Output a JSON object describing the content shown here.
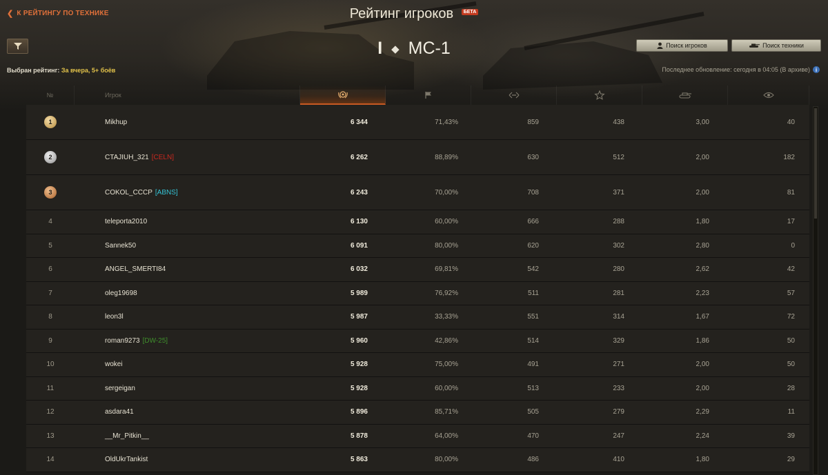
{
  "nav": {
    "back_label": "К РЕЙТИНГУ ПО ТЕХНИКЕ"
  },
  "header": {
    "title": "Рейтинг игроков",
    "beta_badge": "БЕТА",
    "tank_tier": "I",
    "tank_name": "МС-1"
  },
  "toolbar": {
    "player_search_label": "Поиск игроков",
    "tank_search_label": "Поиск техники"
  },
  "selected_rating": {
    "label": "Выбран рейтинг:",
    "value": "За вчера, 5+ боёв"
  },
  "last_update": "Последнее обновление: сегодня в 04:05 (В архиве)",
  "table": {
    "headers": {
      "rank": "№",
      "player": "Игрок",
      "score_icon": "laurel-icon",
      "wins_icon": "flag-icon",
      "damage_icon": "damage-icon",
      "exp_icon": "star-icon",
      "frags_icon": "tank-icon",
      "spotted_icon": "eye-icon"
    },
    "active_column": "score",
    "rows": [
      {
        "rank": "1",
        "player": "Mikhup",
        "clan": "",
        "clan_color": "",
        "score": "6 344",
        "wins": "71,43%",
        "damage": "859",
        "exp": "438",
        "frags": "3,00",
        "spotted": "40"
      },
      {
        "rank": "2",
        "player": "CTAJIUH_321",
        "clan": "[CELN]",
        "clan_color": "#c9281f",
        "score": "6 262",
        "wins": "88,89%",
        "damage": "630",
        "exp": "512",
        "frags": "2,00",
        "spotted": "182"
      },
      {
        "rank": "3",
        "player": "COKOL_CCCP",
        "clan": "[ABNS]",
        "clan_color": "#35c4d6",
        "score": "6 243",
        "wins": "70,00%",
        "damage": "708",
        "exp": "371",
        "frags": "2,00",
        "spotted": "81"
      },
      {
        "rank": "4",
        "player": "teleporta2010",
        "clan": "",
        "clan_color": "",
        "score": "6 130",
        "wins": "60,00%",
        "damage": "666",
        "exp": "288",
        "frags": "1,80",
        "spotted": "17"
      },
      {
        "rank": "5",
        "player": "Sannek50",
        "clan": "",
        "clan_color": "",
        "score": "6 091",
        "wins": "80,00%",
        "damage": "620",
        "exp": "302",
        "frags": "2,80",
        "spotted": "0"
      },
      {
        "rank": "6",
        "player": "ANGEL_SMERTI84",
        "clan": "",
        "clan_color": "",
        "score": "6 032",
        "wins": "69,81%",
        "damage": "542",
        "exp": "280",
        "frags": "2,62",
        "spotted": "42"
      },
      {
        "rank": "7",
        "player": "oleg19698",
        "clan": "",
        "clan_color": "",
        "score": "5 989",
        "wins": "76,92%",
        "damage": "511",
        "exp": "281",
        "frags": "2,23",
        "spotted": "57"
      },
      {
        "rank": "8",
        "player": "leon3l",
        "clan": "",
        "clan_color": "",
        "score": "5 987",
        "wins": "33,33%",
        "damage": "551",
        "exp": "314",
        "frags": "1,67",
        "spotted": "72"
      },
      {
        "rank": "9",
        "player": "roman9273",
        "clan": "[DW-25]",
        "clan_color": "#3f8f2c",
        "score": "5 960",
        "wins": "42,86%",
        "damage": "514",
        "exp": "329",
        "frags": "1,86",
        "spotted": "50"
      },
      {
        "rank": "10",
        "player": "wokei",
        "clan": "",
        "clan_color": "",
        "score": "5 928",
        "wins": "75,00%",
        "damage": "491",
        "exp": "271",
        "frags": "2,00",
        "spotted": "50"
      },
      {
        "rank": "11",
        "player": "sergeigan",
        "clan": "",
        "clan_color": "",
        "score": "5 928",
        "wins": "60,00%",
        "damage": "513",
        "exp": "233",
        "frags": "2,00",
        "spotted": "28"
      },
      {
        "rank": "12",
        "player": "asdara41",
        "clan": "",
        "clan_color": "",
        "score": "5 896",
        "wins": "85,71%",
        "damage": "505",
        "exp": "279",
        "frags": "2,29",
        "spotted": "11"
      },
      {
        "rank": "13",
        "player": "__Mr_Pitkin__",
        "clan": "",
        "clan_color": "",
        "score": "5 878",
        "wins": "64,00%",
        "damage": "470",
        "exp": "247",
        "frags": "2,24",
        "spotted": "39"
      },
      {
        "rank": "14",
        "player": "OldUkrTankist",
        "clan": "",
        "clan_color": "",
        "score": "5 863",
        "wins": "80,00%",
        "damage": "486",
        "exp": "410",
        "frags": "1,80",
        "spotted": "29"
      }
    ]
  }
}
